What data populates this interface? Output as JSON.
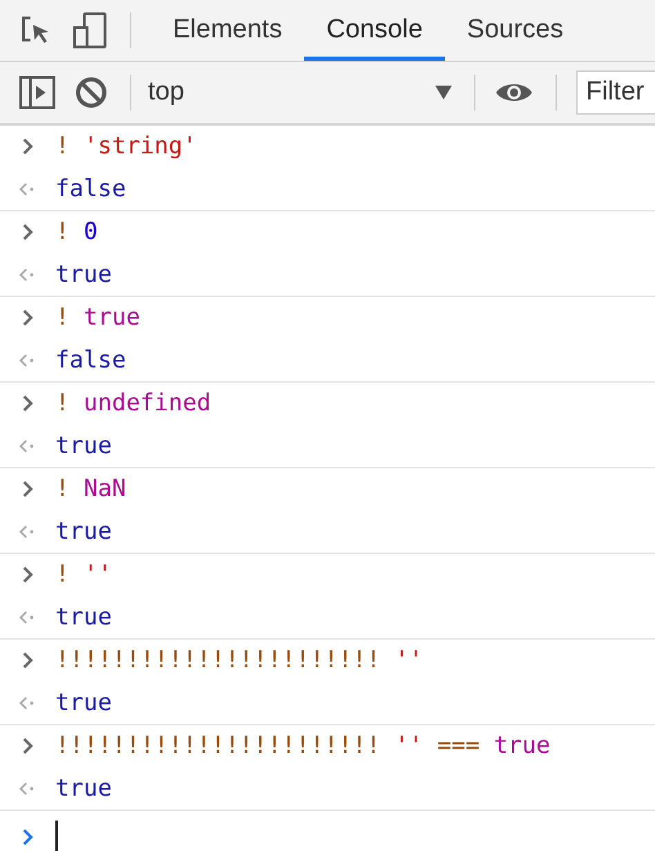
{
  "tabs": [
    {
      "label": "Elements",
      "selected": false
    },
    {
      "label": "Console",
      "selected": true
    },
    {
      "label": "Sources",
      "selected": false
    }
  ],
  "toolbar": {
    "context": "top",
    "filter": {
      "placeholder": "Filter"
    }
  },
  "entries": [
    {
      "input": [
        {
          "kind": "operator",
          "text": "! "
        },
        {
          "kind": "string",
          "text": "'string'"
        }
      ],
      "result": "false"
    },
    {
      "input": [
        {
          "kind": "operator",
          "text": "! "
        },
        {
          "kind": "number",
          "text": "0"
        }
      ],
      "result": "true"
    },
    {
      "input": [
        {
          "kind": "operator",
          "text": "! "
        },
        {
          "kind": "keyword",
          "text": "true"
        }
      ],
      "result": "false"
    },
    {
      "input": [
        {
          "kind": "operator",
          "text": "! "
        },
        {
          "kind": "keyword",
          "text": "undefined"
        }
      ],
      "result": "true"
    },
    {
      "input": [
        {
          "kind": "operator",
          "text": "! "
        },
        {
          "kind": "keyword",
          "text": "NaN"
        }
      ],
      "result": "true"
    },
    {
      "input": [
        {
          "kind": "operator",
          "text": "! "
        },
        {
          "kind": "string",
          "text": "''"
        }
      ],
      "result": "true"
    },
    {
      "input": [
        {
          "kind": "operator",
          "text": "!!!!!!!!!!!!!!!!!!!!!!! "
        },
        {
          "kind": "string",
          "text": "''"
        }
      ],
      "result": "true"
    },
    {
      "input": [
        {
          "kind": "operator",
          "text": "!!!!!!!!!!!!!!!!!!!!!!! "
        },
        {
          "kind": "string",
          "text": "''"
        },
        {
          "kind": "operator",
          "text": " === "
        },
        {
          "kind": "keyword",
          "text": "true"
        }
      ],
      "result": "true"
    }
  ]
}
